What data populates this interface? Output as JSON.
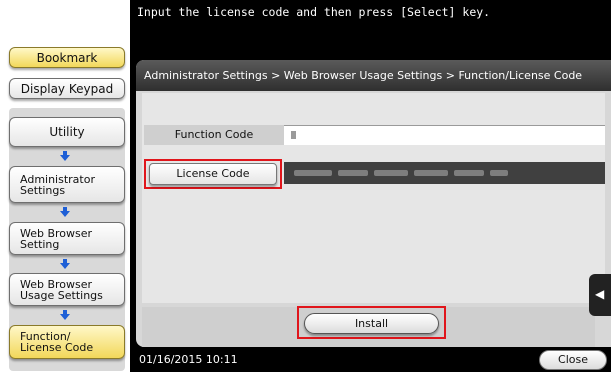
{
  "instruction": "Input the license code and then  press [Select] key.",
  "sidebar": {
    "bookmark_label": "Bookmark",
    "display_keypad_label": "Display Keypad",
    "nav": {
      "utility": "Utility",
      "admin_line1": "Administrator",
      "admin_line2": "Settings",
      "web_line1": "Web Browser",
      "web_line2": "Setting",
      "usage_line1": "Web Browser",
      "usage_line2": "Usage Settings",
      "function_line1": "Function/",
      "function_line2": "License Code"
    }
  },
  "breadcrumb": "Administrator Settings > Web Browser Usage Settings > Function/License Code",
  "form": {
    "function_code_label": "Function Code",
    "license_code_label": "License Code"
  },
  "install_label": "Install",
  "footer": {
    "datetime": "01/16/2015  10:11",
    "close_label": "Close"
  },
  "colors": {
    "highlight": "#e0151b",
    "selected_nav": "#f2d85a",
    "arrow": "#1e5fd6"
  },
  "icons": {
    "nav_arrow": "arrow-down-icon",
    "scroll_tab": "arrow-left-icon"
  }
}
